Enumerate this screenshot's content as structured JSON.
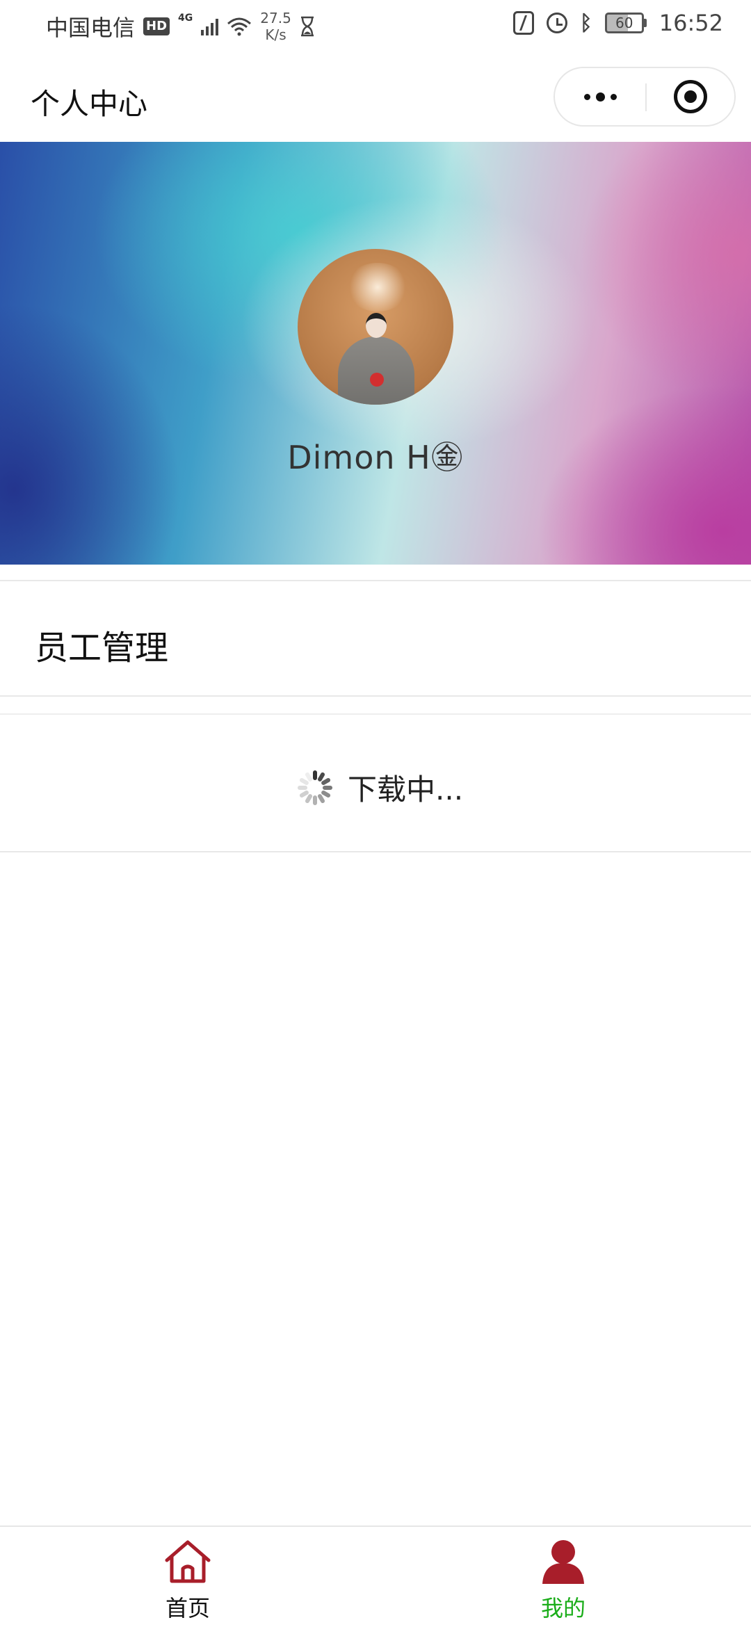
{
  "status_bar": {
    "carrier": "中国电信",
    "hd": "HD",
    "network": "4G",
    "speed_value": "27.5",
    "speed_unit": "K/s",
    "battery": "60",
    "time": "16:52"
  },
  "header": {
    "title": "个人中心",
    "more_icon": "more-dots-icon",
    "close_icon": "target-circle-icon"
  },
  "profile": {
    "username": "Dimon H㊎"
  },
  "menu": {
    "items": [
      {
        "label": "员工管理"
      }
    ]
  },
  "loading": {
    "text": "下载中..."
  },
  "tab_bar": {
    "active_color": "#1aad19",
    "icon_color": "#a81e2a",
    "items": [
      {
        "label": "首页",
        "icon": "home-icon"
      },
      {
        "label": "我的",
        "icon": "user-icon"
      }
    ]
  }
}
